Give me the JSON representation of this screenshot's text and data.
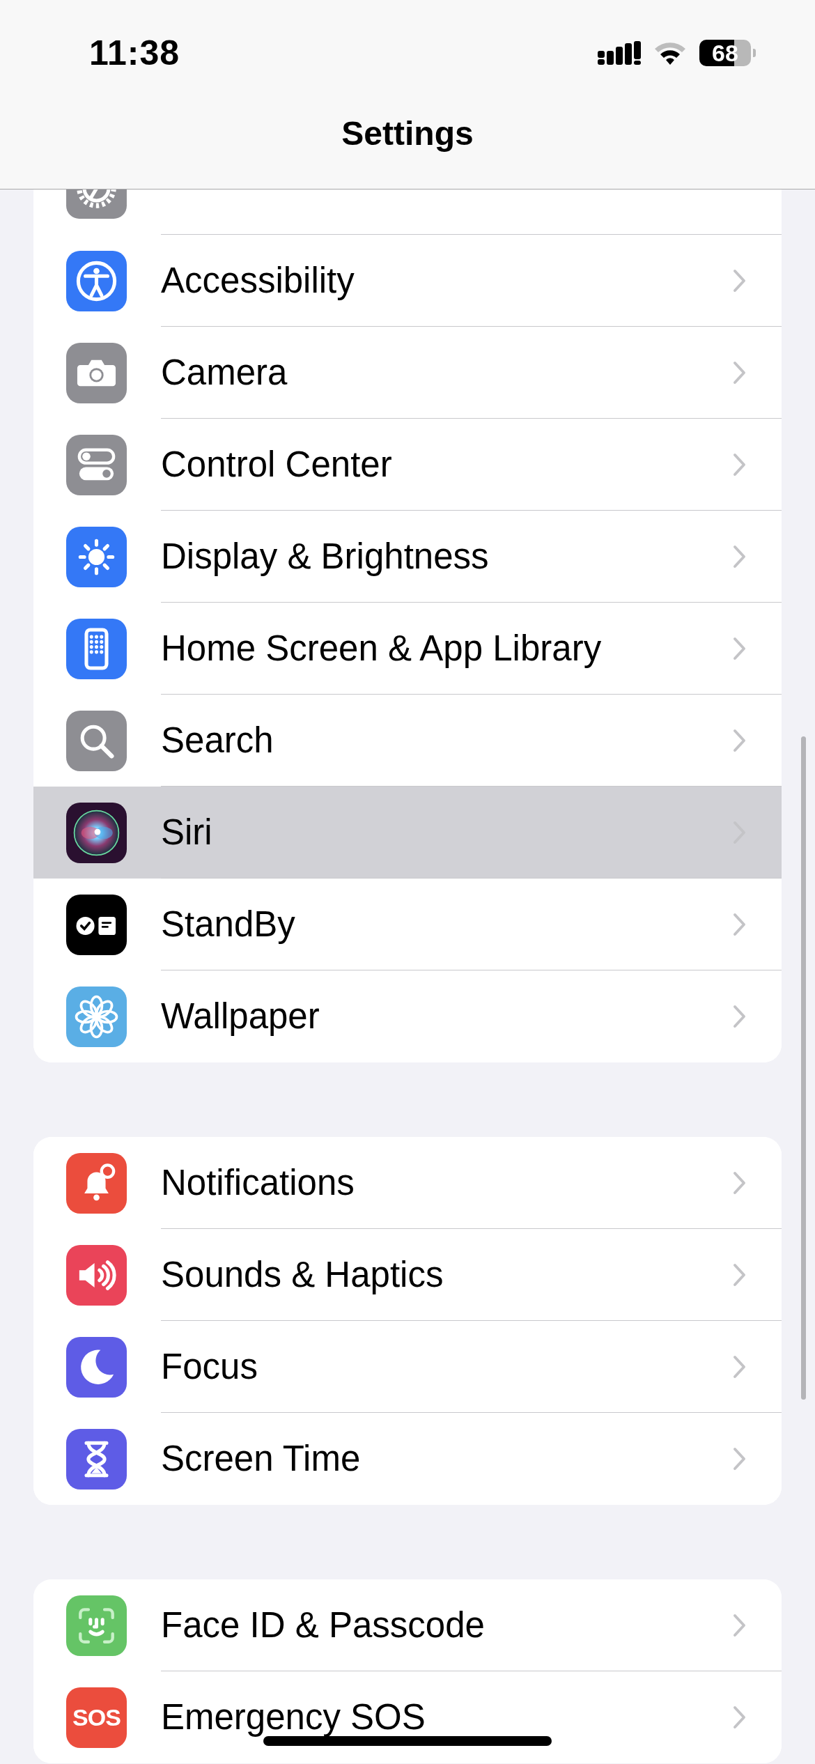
{
  "status_bar": {
    "time": "11:38",
    "battery": "68"
  },
  "nav": {
    "title": "Settings"
  },
  "groups": [
    {
      "clipped_top": true,
      "rows": [
        {
          "label": "Accessibility",
          "selected": false
        },
        {
          "label": "Camera",
          "selected": false
        },
        {
          "label": "Control Center",
          "selected": false
        },
        {
          "label": "Display & Brightness",
          "selected": false
        },
        {
          "label": "Home Screen & App Library",
          "selected": false
        },
        {
          "label": "Search",
          "selected": false
        },
        {
          "label": "Siri",
          "selected": true
        },
        {
          "label": "StandBy",
          "selected": false
        },
        {
          "label": "Wallpaper",
          "selected": false
        }
      ]
    },
    {
      "rows": [
        {
          "label": "Notifications",
          "selected": false
        },
        {
          "label": "Sounds & Haptics",
          "selected": false
        },
        {
          "label": "Focus",
          "selected": false
        },
        {
          "label": "Screen Time",
          "selected": false
        }
      ]
    },
    {
      "rows": [
        {
          "label": "Face ID & Passcode",
          "selected": false
        },
        {
          "label": "Emergency SOS",
          "selected": false,
          "icon_text": "SOS"
        }
      ]
    }
  ]
}
